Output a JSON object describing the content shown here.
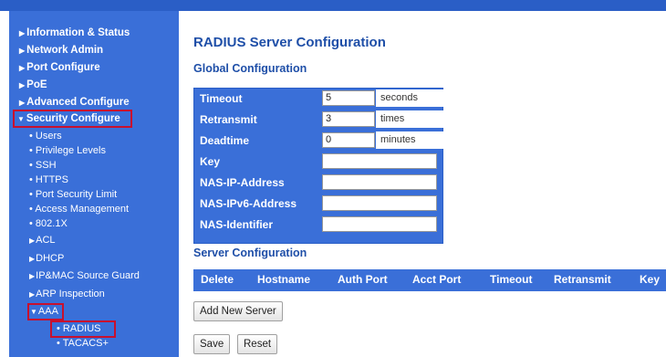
{
  "sidebar": {
    "top_items": [
      {
        "caret": "▶",
        "label": "Information & Status"
      },
      {
        "caret": "▶",
        "label": "Network Admin"
      },
      {
        "caret": "▶",
        "label": "Port Configure"
      },
      {
        "caret": "▶",
        "label": "PoE"
      },
      {
        "caret": "▶",
        "label": "Advanced Configure"
      }
    ],
    "security": {
      "caret": "▼",
      "label": "Security Configure"
    },
    "security_items": [
      {
        "bullet": "•",
        "label": "Users"
      },
      {
        "bullet": "•",
        "label": "Privilege Levels"
      },
      {
        "bullet": "•",
        "label": "SSH"
      },
      {
        "bullet": "•",
        "label": "HTTPS"
      },
      {
        "bullet": "•",
        "label": "Port Security Limit"
      },
      {
        "bullet": "•",
        "label": "Access Management"
      },
      {
        "bullet": "•",
        "label": "802.1X"
      },
      {
        "bullet": "▶",
        "label": "ACL"
      },
      {
        "bullet": "▶",
        "label": "DHCP"
      },
      {
        "bullet": "▶",
        "label": "IP&MAC Source Guard"
      },
      {
        "bullet": "▶",
        "label": "ARP Inspection"
      }
    ],
    "aaa": {
      "caret": "▼",
      "label": "AAA"
    },
    "aaa_items": [
      {
        "bullet": "•",
        "label": "RADIUS"
      },
      {
        "bullet": "•",
        "label": "TACACS+"
      }
    ]
  },
  "main": {
    "title": "RADIUS Server Configuration",
    "global_title": "Global Configuration",
    "global_rows": [
      {
        "label": "Timeout",
        "value": "5",
        "unit": "seconds"
      },
      {
        "label": "Retransmit",
        "value": "3",
        "unit": "times"
      },
      {
        "label": "Deadtime",
        "value": "0",
        "unit": "minutes"
      },
      {
        "label": "Key",
        "value": ""
      },
      {
        "label": "NAS-IP-Address",
        "value": ""
      },
      {
        "label": "NAS-IPv6-Address",
        "value": ""
      },
      {
        "label": "NAS-Identifier",
        "value": ""
      }
    ],
    "server_title": "Server Configuration",
    "server_columns": [
      "Delete",
      "Hostname",
      "Auth Port",
      "Acct Port",
      "Timeout",
      "Retransmit",
      "Key"
    ],
    "add_button": "Add New Server",
    "save_button": "Save",
    "reset_button": "Reset"
  },
  "colors": {
    "accent": "#3a6fd8",
    "title": "#1f4fa8",
    "highlight": "#c8102e"
  }
}
